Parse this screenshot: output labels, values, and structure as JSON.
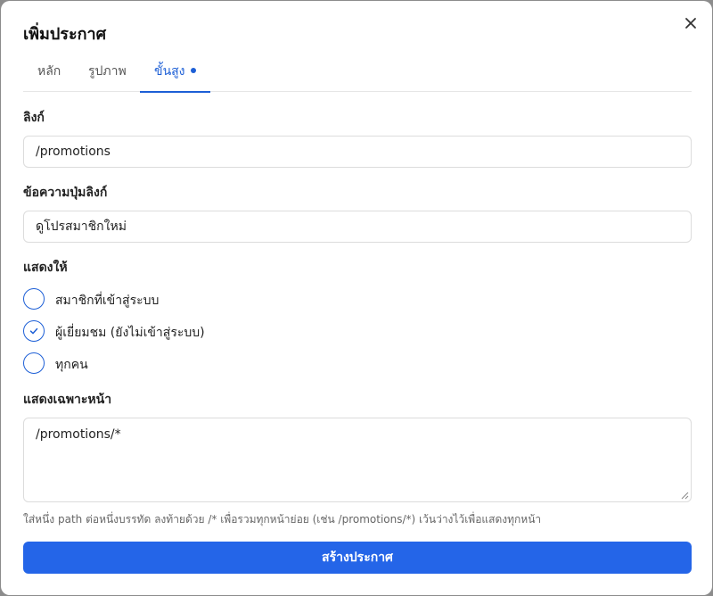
{
  "dialog": {
    "title": "เพิ่มประกาศ",
    "close_icon": "close-icon"
  },
  "tabs": [
    {
      "label": "หลัก",
      "active": false
    },
    {
      "label": "รูปภาพ",
      "active": false
    },
    {
      "label": "ขั้นสูง",
      "active": true,
      "has_dot": true
    }
  ],
  "link": {
    "label": "ลิงก์",
    "value": "/promotions"
  },
  "button_text": {
    "label": "ข้อความปุ่มลิงก์",
    "value": "ดูโปรสมาชิกใหม่"
  },
  "audience": {
    "label": "แสดงให้",
    "options": [
      {
        "label": "สมาชิกที่เข้าสู่ระบบ",
        "checked": false
      },
      {
        "label": "ผู้เยี่ยมชม (ยังไม่เข้าสู่ระบบ)",
        "checked": true
      },
      {
        "label": "ทุกคน",
        "checked": false
      }
    ]
  },
  "pages": {
    "label": "แสดงเฉพาะหน้า",
    "value": "/promotions/*",
    "hint": "ใส่หนึ่ง path ต่อหนึ่งบรรทัด ลงท้ายด้วย /* เพื่อรวมทุกหน้าย่อย (เช่น /promotions/*) เว้นว่างไว้เพื่อแสดงทุกหน้า"
  },
  "submit": {
    "label": "สร้างประกาศ"
  },
  "colors": {
    "accent": "#2465e8",
    "tab_active": "#1d5fd6"
  }
}
